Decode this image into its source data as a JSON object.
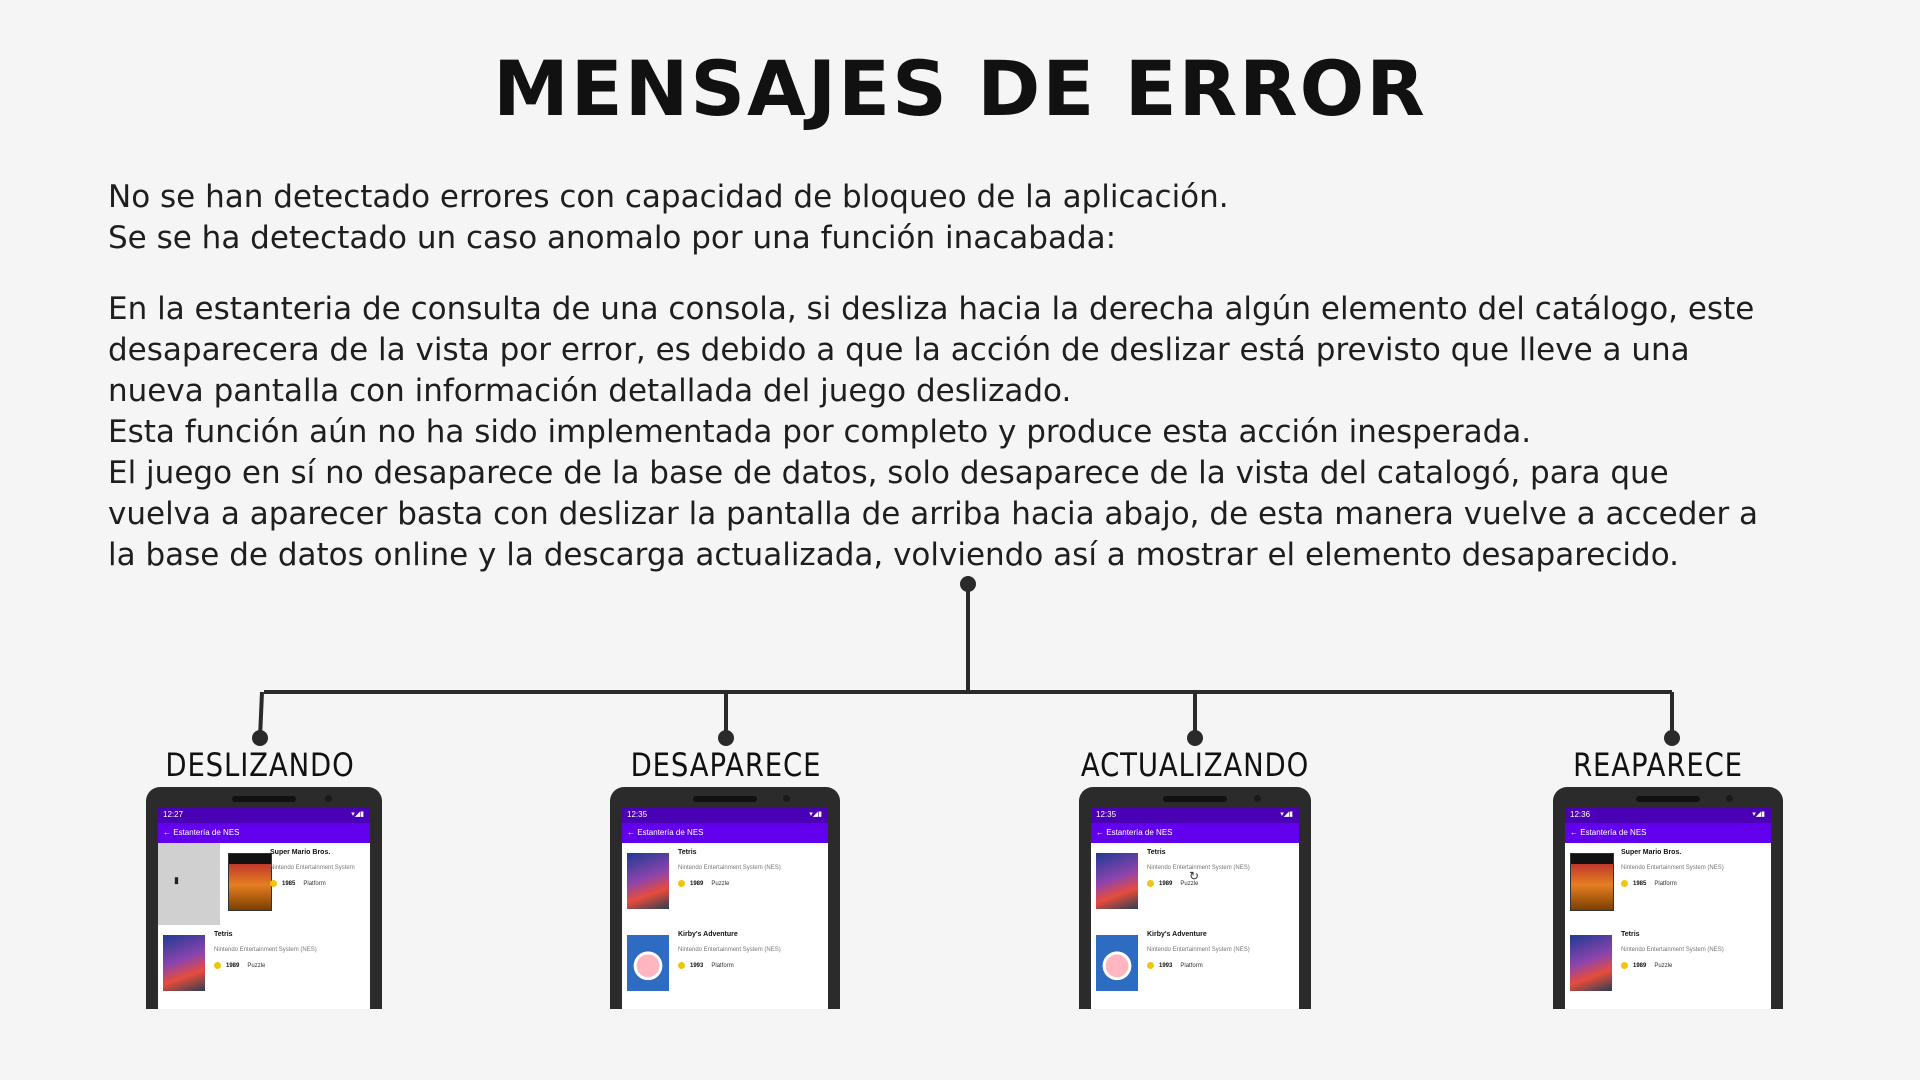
{
  "title": "MENSAJES DE ERROR",
  "intro": [
    "No se han detectado errores con capacidad de bloqueo de la aplicación.",
    "Se se ha detectado un caso anomalo por una función inacabada:"
  ],
  "details": [
    "En la estanteria de consulta de una consola, si desliza hacia la derecha algún elemento del catálogo, este",
    "desaparecera de la vista por error, es debido a que la acción de deslizar está previsto que lleve a una",
    "nueva pantalla con información detallada del juego deslizado.",
    "Esta función aún no ha sido implementada por completo y produce esta acción inesperada.",
    "El juego en sí no desaparece de la base de datos, solo desaparece de la vista del catalogó, para que",
    "vuelva a aparecer basta con deslizar la pantalla de arriba hacia abajo, de esta manera vuelve a acceder a",
    "la base de datos online y la descarga actualizada, volviendo así a mostrar el elemento desaparecido."
  ],
  "colors": {
    "status_bar": "#4a00b4",
    "app_bar": "#6200ee",
    "rating_dot": "#f1c40f"
  },
  "steps": [
    {
      "label": "DESLIZANDO",
      "time": "12:27",
      "appbar": "Estantería de NES",
      "games": [
        {
          "name": "Super Mario Bros.",
          "system": "Nintendo Entertainment System",
          "year": "1985",
          "genre": "Platform",
          "cover": "mario"
        },
        {
          "name": "Tetris",
          "system": "Nintendo Entertainment System (NES)",
          "year": "1989",
          "genre": "Puzzle",
          "cover": "tetris"
        }
      ]
    },
    {
      "label": "DESAPARECE",
      "time": "12:35",
      "appbar": "Estantería de NES",
      "games": [
        {
          "name": "Tetris",
          "system": "Nintendo Entertainment System (NES)",
          "year": "1989",
          "genre": "Puzzle",
          "cover": "tetris"
        },
        {
          "name": "Kirby's Adventure",
          "system": "Nintendo Entertainment System (NES)",
          "year": "1993",
          "genre": "Platform",
          "cover": "kirby"
        }
      ]
    },
    {
      "label": "ACTUALIZANDO",
      "time": "12:35",
      "appbar": "Estantería de NES",
      "games": [
        {
          "name": "Tetris",
          "system": "Nintendo Entertainment System (NES)",
          "year": "1989",
          "genre": "Puzzle",
          "cover": "tetris"
        },
        {
          "name": "Kirby's Adventure",
          "system": "Nintendo Entertainment System (NES)",
          "year": "1993",
          "genre": "Platform",
          "cover": "kirby"
        }
      ]
    },
    {
      "label": "REAPARECE",
      "time": "12:36",
      "appbar": "Estantería de NES",
      "games": [
        {
          "name": "Super Mario Bros.",
          "system": "Nintendo Entertainment System (NES)",
          "year": "1985",
          "genre": "Platform",
          "cover": "mario"
        },
        {
          "name": "Tetris",
          "system": "Nintendo Entertainment System (NES)",
          "year": "1989",
          "genre": "Puzzle",
          "cover": "tetris"
        }
      ]
    }
  ]
}
